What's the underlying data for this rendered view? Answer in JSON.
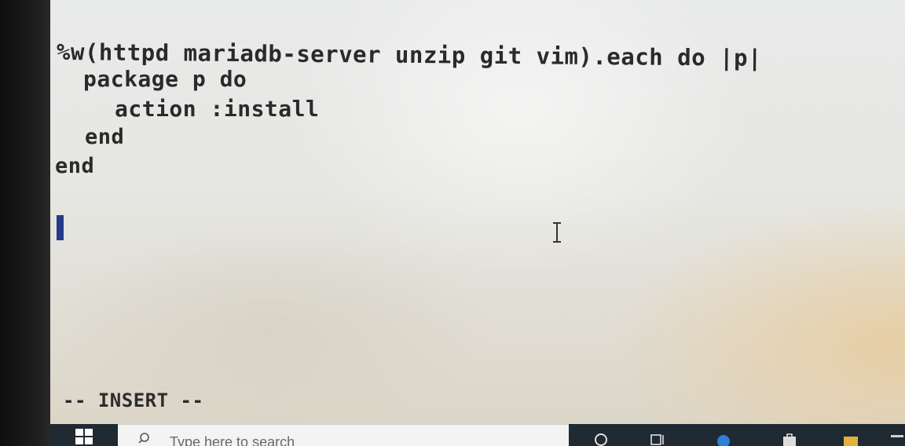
{
  "editor": {
    "lines": [
      "%w(httpd mariadb-server unzip git vim).each do |p|",
      "package p do",
      "action :install",
      "end",
      "end"
    ],
    "mode": "-- INSERT --"
  },
  "taskbar": {
    "search_placeholder": "Type here to search",
    "icons": [
      "windows-start-icon",
      "search-icon",
      "task-view-icon",
      "taskbar-app-icon",
      "edge-icon",
      "store-icon",
      "folder-icon"
    ]
  },
  "colors": {
    "screen_bg": "#e8e8e6",
    "text": "#2a2a2a",
    "cursor": "#243a8a",
    "taskbar": "#1f2a33"
  }
}
